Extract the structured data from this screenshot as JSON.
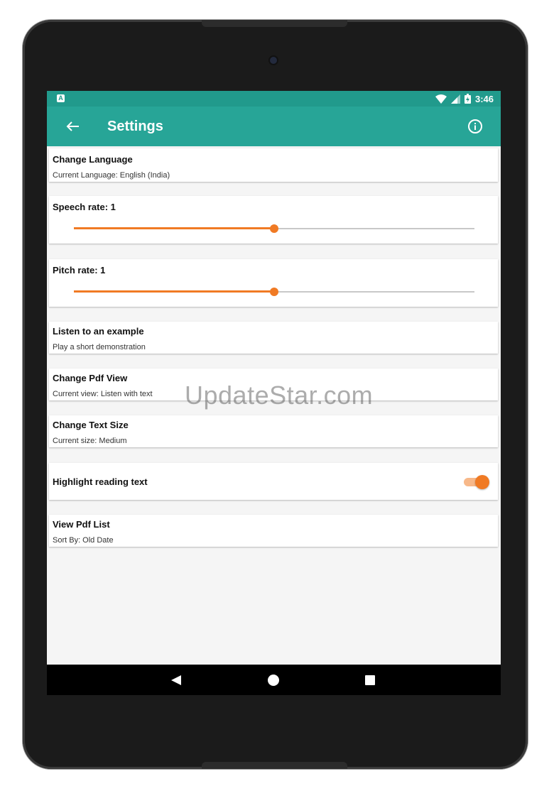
{
  "status_bar": {
    "time": "3:46",
    "app_icon_letter": "A"
  },
  "app_bar": {
    "title": "Settings",
    "back_icon": "arrow-left-icon",
    "info_icon": "info-icon"
  },
  "settings": {
    "language": {
      "title": "Change Language",
      "subtitle": "Current Language: English (India)"
    },
    "speech_rate": {
      "title": "Speech rate: 1",
      "value": 0.5
    },
    "pitch_rate": {
      "title": "Pitch rate: 1",
      "value": 0.5
    },
    "example": {
      "title": "Listen to an example",
      "subtitle": "Play a short demonstration"
    },
    "pdf_view": {
      "title": "Change Pdf View",
      "subtitle": "Current view: Listen with text"
    },
    "text_size": {
      "title": "Change Text Size",
      "subtitle": "Current size: Medium"
    },
    "highlight": {
      "title": "Highlight reading text",
      "enabled": true
    },
    "pdf_list": {
      "title": "View Pdf List",
      "subtitle": "Sort By: Old Date"
    }
  },
  "colors": {
    "accent": "#f07a24",
    "primary": "#27a597",
    "primary_dark": "#219a8c"
  },
  "watermark": "UpdateStar.com"
}
